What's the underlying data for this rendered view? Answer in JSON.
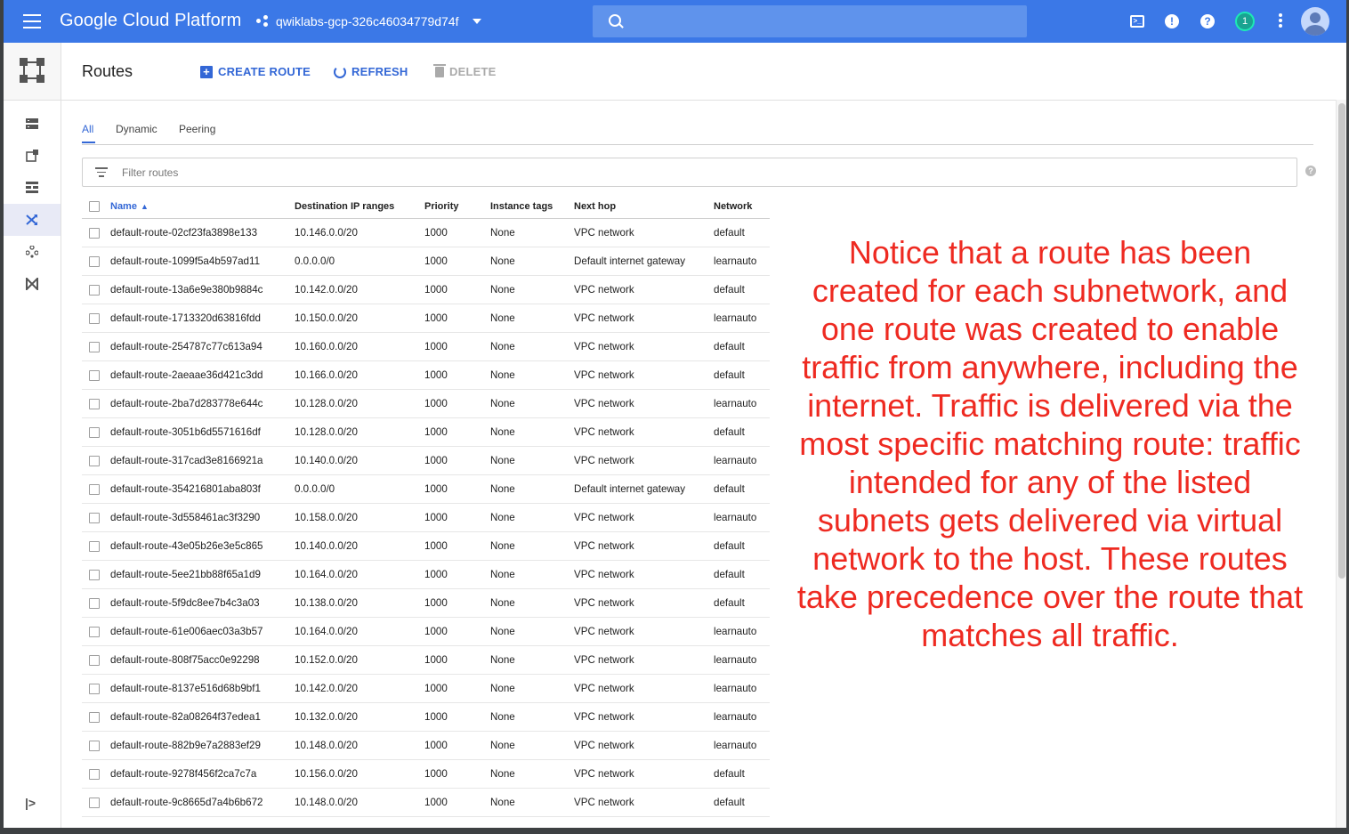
{
  "topbar": {
    "brand": "Google Cloud Platform",
    "project": "qwiklabs-gcp-326c46034779d74f",
    "search_placeholder": "",
    "notification_count": "1"
  },
  "header": {
    "title": "Routes",
    "create_label": "CREATE ROUTE",
    "refresh_label": "REFRESH",
    "delete_label": "DELETE"
  },
  "tabs": [
    "All",
    "Dynamic",
    "Peering"
  ],
  "filter": {
    "placeholder": "Filter routes"
  },
  "table": {
    "columns": [
      "Name",
      "Destination IP ranges",
      "Priority",
      "Instance tags",
      "Next hop",
      "Network"
    ],
    "rows": [
      [
        "default-route-02cf23fa3898e133",
        "10.146.0.0/20",
        "1000",
        "None",
        "VPC network",
        "default"
      ],
      [
        "default-route-1099f5a4b597ad11",
        "0.0.0.0/0",
        "1000",
        "None",
        "Default internet gateway",
        "learnauto"
      ],
      [
        "default-route-13a6e9e380b9884c",
        "10.142.0.0/20",
        "1000",
        "None",
        "VPC network",
        "default"
      ],
      [
        "default-route-1713320d63816fdd",
        "10.150.0.0/20",
        "1000",
        "None",
        "VPC network",
        "learnauto"
      ],
      [
        "default-route-254787c77c613a94",
        "10.160.0.0/20",
        "1000",
        "None",
        "VPC network",
        "default"
      ],
      [
        "default-route-2aeaae36d421c3dd",
        "10.166.0.0/20",
        "1000",
        "None",
        "VPC network",
        "default"
      ],
      [
        "default-route-2ba7d283778e644c",
        "10.128.0.0/20",
        "1000",
        "None",
        "VPC network",
        "learnauto"
      ],
      [
        "default-route-3051b6d5571616df",
        "10.128.0.0/20",
        "1000",
        "None",
        "VPC network",
        "default"
      ],
      [
        "default-route-317cad3e8166921a",
        "10.140.0.0/20",
        "1000",
        "None",
        "VPC network",
        "learnauto"
      ],
      [
        "default-route-354216801aba803f",
        "0.0.0.0/0",
        "1000",
        "None",
        "Default internet gateway",
        "default"
      ],
      [
        "default-route-3d558461ac3f3290",
        "10.158.0.0/20",
        "1000",
        "None",
        "VPC network",
        "learnauto"
      ],
      [
        "default-route-43e05b26e3e5c865",
        "10.140.0.0/20",
        "1000",
        "None",
        "VPC network",
        "default"
      ],
      [
        "default-route-5ee21bb88f65a1d9",
        "10.164.0.0/20",
        "1000",
        "None",
        "VPC network",
        "default"
      ],
      [
        "default-route-5f9dc8ee7b4c3a03",
        "10.138.0.0/20",
        "1000",
        "None",
        "VPC network",
        "default"
      ],
      [
        "default-route-61e006aec03a3b57",
        "10.164.0.0/20",
        "1000",
        "None",
        "VPC network",
        "learnauto"
      ],
      [
        "default-route-808f75acc0e92298",
        "10.152.0.0/20",
        "1000",
        "None",
        "VPC network",
        "learnauto"
      ],
      [
        "default-route-8137e516d68b9bf1",
        "10.142.0.0/20",
        "1000",
        "None",
        "VPC network",
        "learnauto"
      ],
      [
        "default-route-82a08264f37edea1",
        "10.132.0.0/20",
        "1000",
        "None",
        "VPC network",
        "learnauto"
      ],
      [
        "default-route-882b9e7a2883ef29",
        "10.148.0.0/20",
        "1000",
        "None",
        "VPC network",
        "learnauto"
      ],
      [
        "default-route-9278f456f2ca7c7a",
        "10.156.0.0/20",
        "1000",
        "None",
        "VPC network",
        "default"
      ],
      [
        "default-route-9c8665d7a4b6b672",
        "10.148.0.0/20",
        "1000",
        "None",
        "VPC network",
        "default"
      ]
    ]
  },
  "annotation": "Notice that a route has been created for each subnetwork, and one route was created to enable traffic from anywhere, including the internet. Traffic is delivered via the most specific matching route: traffic intended for any of the listed subnets gets delivered via virtual network to the host. These routes take precedence over the route that matches all traffic.",
  "colors": {
    "topbar": "#3b78e7",
    "accent": "#3367d6",
    "annotation": "#ee2a21"
  }
}
